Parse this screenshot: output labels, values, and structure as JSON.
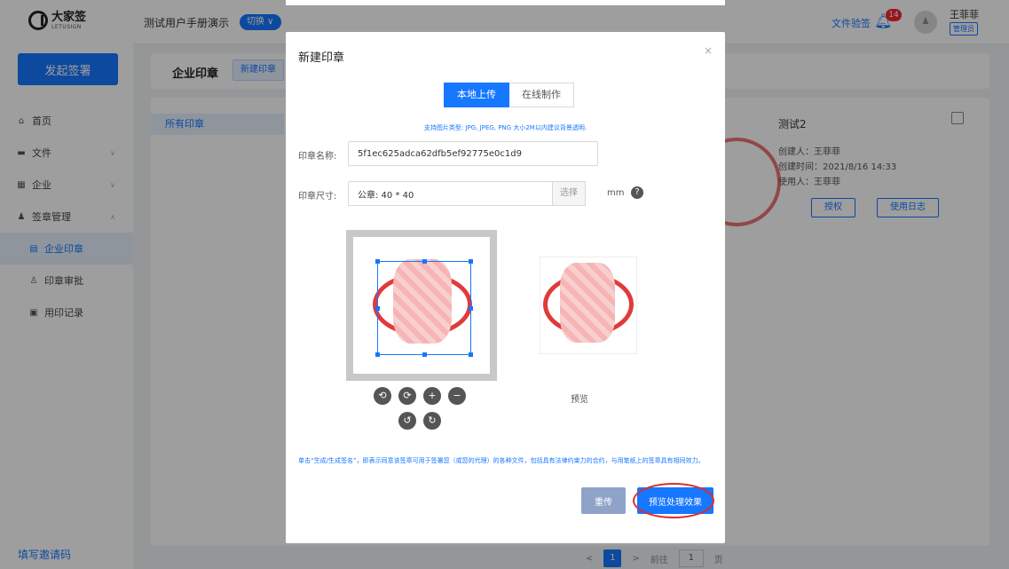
{
  "sidebar": {
    "logo_cn": "大家签",
    "logo_en": "LETUSIGN",
    "start_button": "发起签署",
    "items": [
      {
        "label": "首页",
        "icon": "home-icon"
      },
      {
        "label": "文件",
        "icon": "folder-icon"
      },
      {
        "label": "企业",
        "icon": "building-icon"
      },
      {
        "label": "签章管理",
        "icon": "user-icon"
      },
      {
        "label": "企业印章",
        "icon": "doc-icon"
      },
      {
        "label": "印章审批",
        "icon": "approve-icon"
      },
      {
        "label": "用印记录",
        "icon": "record-icon"
      }
    ],
    "invite": "填写邀请码"
  },
  "header": {
    "title": "测试用户手册演示",
    "switch": "切换",
    "verify": "文件验签",
    "badge": "14",
    "user_name": "王菲菲",
    "user_role": "管理员"
  },
  "page": {
    "tab_label": "企业印章",
    "new_seal": "新建印章",
    "all_seals": "所有印章",
    "card": {
      "title": "测试2",
      "creator": "创建人：王菲菲",
      "created_time": "创建时间：2021/8/16 14:33",
      "user": "使用人：王菲菲",
      "authorize": "授权",
      "log": "使用日志"
    },
    "pager": {
      "prev": "<",
      "current": "1",
      "next": ">",
      "goto": "前往",
      "goto_value": "1",
      "page_unit": "页"
    }
  },
  "modal": {
    "title": "新建印章",
    "close": "×",
    "tab_upload": "本地上传",
    "tab_online": "在线制作",
    "hint": "支持图片类型: JPG, JPEG, PNG 大小2M以内建议背景透明.",
    "name_label": "印章名称:",
    "name_value": "5f1ec625adca62dfb5ef92775e0c1d9",
    "size_label": "印章尺寸:",
    "size_value": "公章: 40 * 40",
    "select": "选择",
    "unit": "mm",
    "help": "?",
    "preview_label": "预览",
    "tools": [
      "⟲",
      "⟳",
      "+",
      "−",
      "↺",
      "↻"
    ],
    "legal": "单击“生成/生成签名”，即表示同意该签章可用于签署您（或您的代理）的各种文件，包括具有法律约束力的合约，与用笔纸上的签章具有相同效力。",
    "reupload": "重传",
    "preview_button": "预览处理效果"
  },
  "colors": {
    "accent": "#1677ff",
    "stamp_red": "#e03a3a"
  }
}
